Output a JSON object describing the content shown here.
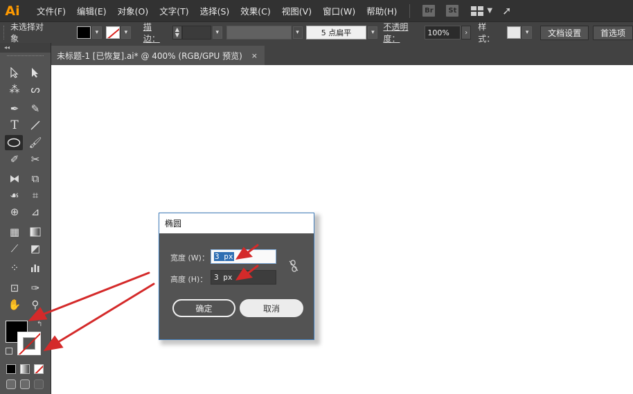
{
  "app": {
    "logo": "Ai"
  },
  "menu": [
    "文件(F)",
    "编辑(E)",
    "对象(O)",
    "文字(T)",
    "选择(S)",
    "效果(C)",
    "视图(V)",
    "窗口(W)",
    "帮助(H)"
  ],
  "app_buttons": {
    "bridge": "Br",
    "stock": "St"
  },
  "control": {
    "selection_label": "未选择对象",
    "stroke_label": "描边：",
    "stroke_profile": "5 点扁平",
    "opacity_label": "不透明度：",
    "opacity_value": "100%",
    "style_label": "样式：",
    "doc_settings": "文档设置",
    "preferences": "首选项"
  },
  "document": {
    "tab_title": "未标题-1 [已恢复].ai* @ 400% (RGB/GPU 预览)",
    "close": "×"
  },
  "dialog": {
    "title": "椭圆",
    "width_label": "宽度 (W)：",
    "width_value": "3 px",
    "height_label": "高度 (H)：",
    "height_value": "3 px",
    "ok": "确定",
    "cancel": "取消"
  },
  "colors": {
    "annotation_arrow": "#d42a2a",
    "illustrator_orange": "#ff9a00",
    "selection_blue": "#2f6fb3"
  },
  "icons": [
    "selection-tool-icon",
    "direct-selection-tool-icon",
    "magic-wand-icon",
    "lasso-icon",
    "pen-tool-icon",
    "curvature-tool-icon",
    "type-tool-icon",
    "line-tool-icon",
    "ellipse-tool-icon",
    "paintbrush-icon",
    "shaper-tool-icon",
    "scissors-icon",
    "rotate-tool-icon",
    "scale-tool-icon",
    "warp-tool-icon",
    "free-transform-icon",
    "shape-builder-icon",
    "perspective-grid-icon",
    "mesh-tool-icon",
    "gradient-tool-icon",
    "eyedropper-icon",
    "blend-tool-icon",
    "symbol-sprayer-icon",
    "column-graph-icon",
    "artboard-tool-icon",
    "slice-tool-icon",
    "hand-tool-icon",
    "zoom-tool-icon",
    "constrain-link-icon"
  ]
}
